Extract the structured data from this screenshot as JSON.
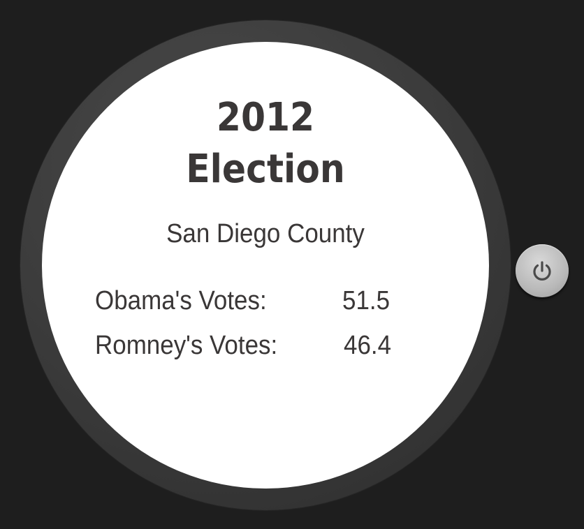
{
  "watch": {
    "title_year": "2012",
    "title_word": "Election",
    "county": "San Diego County",
    "rows": [
      {
        "label": "Obama's Votes:",
        "value": "51.5"
      },
      {
        "label": "Romney's Votes:",
        "value": "46.4"
      }
    ]
  },
  "controls": {
    "power_icon": "power-icon"
  },
  "colors": {
    "background": "#1e1e1e",
    "bezel": "#3a3a3a",
    "face": "#ffffff",
    "text": "#3a3737",
    "button": "#b9b9b9"
  }
}
